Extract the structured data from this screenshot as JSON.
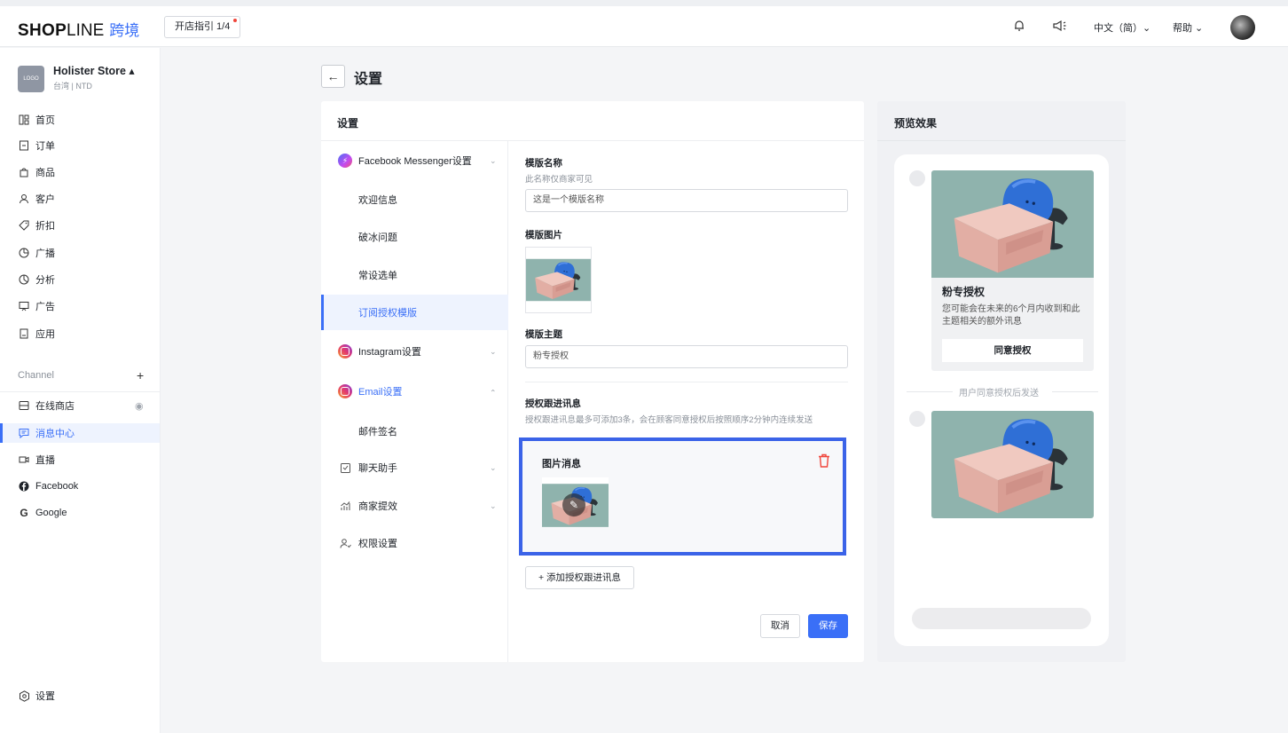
{
  "header": {
    "brand_bold": "SHOP",
    "brand_light": "LINE",
    "brand_cross": "跨境",
    "guide_label": "开店指引 1/4",
    "lang_label": "中文（简）⌄",
    "help_label": "帮助 ⌄"
  },
  "store": {
    "logo_text": "LOGO",
    "name": "Holister Store ▴",
    "sub": "台湾 | NTD"
  },
  "nav": {
    "items": [
      {
        "label": "首页"
      },
      {
        "label": "订单"
      },
      {
        "label": "商品"
      },
      {
        "label": "客户"
      },
      {
        "label": "折扣"
      },
      {
        "label": "广播"
      },
      {
        "label": "分析"
      },
      {
        "label": "广告"
      },
      {
        "label": "应用"
      }
    ],
    "channel_label": "Channel",
    "channel_add": "+",
    "channels": [
      {
        "label": "在线商店"
      },
      {
        "label": "消息中心"
      },
      {
        "label": "直播"
      },
      {
        "label": "Facebook"
      },
      {
        "label": "Google"
      }
    ],
    "settings_label": "设置"
  },
  "page": {
    "title": "设置"
  },
  "settings_card": {
    "title": "设置",
    "menu": [
      {
        "label": "Facebook Messenger设置"
      },
      {
        "label": "欢迎信息"
      },
      {
        "label": "破冰问题"
      },
      {
        "label": "常设选单"
      },
      {
        "label": "订阅授权模版"
      },
      {
        "label": "Instagram设置"
      },
      {
        "label": "Email设置"
      },
      {
        "label": "邮件签名"
      },
      {
        "label": "聊天助手"
      },
      {
        "label": "商家提效"
      },
      {
        "label": "权限设置"
      }
    ]
  },
  "form": {
    "name_label": "模版名称",
    "name_help": "此名称仅商家可见",
    "name_value": "这是一个模版名称",
    "image_label": "模版图片",
    "subject_label": "模版主题",
    "subject_value": "粉专授权",
    "followup_label": "授权跟进讯息",
    "followup_help": "授权跟进讯息最多可添加3条，会在顾客同意授权后按照顺序2分钟内连续发送",
    "image_msg_title": "图片消息",
    "edit_glyph": "✎",
    "add_label": "+ 添加授权跟进讯息",
    "cancel_label": "取消",
    "save_label": "保存"
  },
  "preview": {
    "title": "预览效果",
    "card_title": "粉专授权",
    "card_desc": "您可能会在未来的6个月内收到和此主题相关的额外讯息",
    "card_button": "同意授权",
    "separator_text": "用户同意授权后发送"
  },
  "colors": {
    "accent": "#3a6ff7",
    "highlight_border": "#3b63e8",
    "danger": "#f0443a"
  }
}
